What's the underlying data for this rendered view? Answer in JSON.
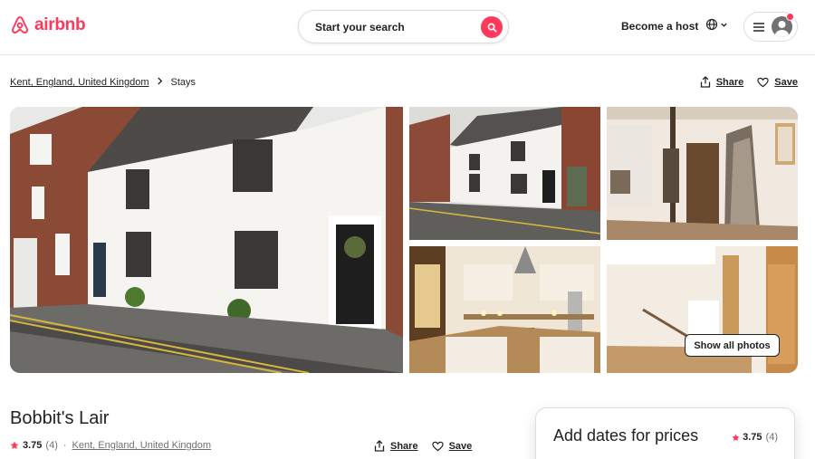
{
  "brand": {
    "name": "airbnb",
    "color": "#ff385c"
  },
  "header": {
    "search_placeholder": "Start your search",
    "become_host": "Become a host",
    "icons": {
      "logo": "airbnb-logo-icon",
      "search": "search-icon",
      "globe": "globe-icon",
      "menu": "hamburger-icon",
      "avatar": "user-avatar-icon"
    }
  },
  "breadcrumb": {
    "location": "Kent, England, United Kingdom",
    "separator": "›",
    "current": "Stays"
  },
  "actions": {
    "share": "Share",
    "save": "Save"
  },
  "gallery": {
    "photos": [
      "house-exterior",
      "street-view",
      "hallway-staircase",
      "kitchen",
      "landing-staircase"
    ],
    "show_all": "Show all photos"
  },
  "listing": {
    "title": "Bobbit's Lair",
    "rating": "3.75",
    "reviews": "(4)",
    "separator": "·",
    "location": "Kent, England, United Kingdom"
  },
  "booking_card": {
    "title": "Add dates for prices",
    "rating": "3.75",
    "reviews": "(4)"
  }
}
